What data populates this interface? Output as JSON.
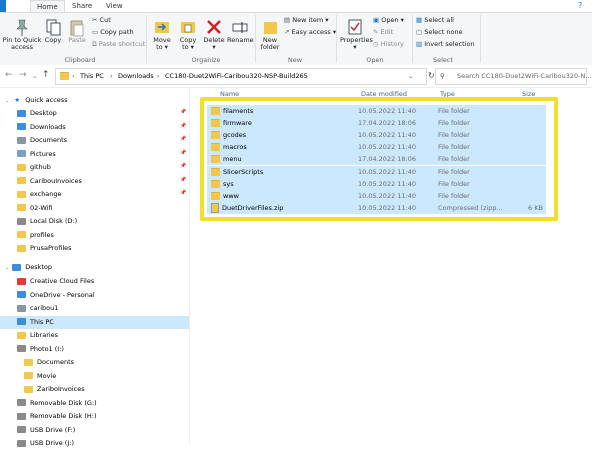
{
  "tabs": [
    "Home",
    "Share",
    "View"
  ],
  "ribbon": {
    "clipboard": {
      "pin": "Pin to Quick access",
      "copy": "Copy",
      "paste": "Paste",
      "cut": "Cut",
      "copy_path": "Copy path",
      "paste_shortcut": "Paste shortcut",
      "label": "Clipboard"
    },
    "organize": {
      "move_to": "Move to",
      "copy_to": "Copy to",
      "delete": "Delete",
      "rename": "Rename",
      "label": "Organize"
    },
    "new": {
      "new_folder": "New folder",
      "new_item": "New item",
      "easy_access": "Easy access",
      "label": "New"
    },
    "open": {
      "properties": "Properties",
      "open": "Open",
      "edit": "Edit",
      "history": "History",
      "label": "Open"
    },
    "select": {
      "select_all": "Select all",
      "select_none": "Select none",
      "invert": "Invert selection",
      "label": "Select"
    }
  },
  "address": {
    "crumbs": [
      "This PC",
      "Downloads",
      "CC180-Duet2WiFi-Caribou320-NSP-Build265"
    ],
    "search_placeholder": "Search CC180-Duet2WiFi-Caribou320-N..."
  },
  "columns": {
    "name": "Name",
    "date": "Date modified",
    "type": "Type",
    "size": "Size"
  },
  "sidebar": {
    "quick_access": "Quick access",
    "items": [
      {
        "label": "Desktop",
        "pinned": true
      },
      {
        "label": "Downloads",
        "pinned": true
      },
      {
        "label": "Documents",
        "pinned": true
      },
      {
        "label": "Pictures",
        "pinned": true
      },
      {
        "label": "github",
        "pinned": true
      },
      {
        "label": "CaribouInvoices",
        "pinned": true
      },
      {
        "label": "exchange",
        "pinned": true
      },
      {
        "label": "02-Wifi",
        "pinned": false
      },
      {
        "label": "Local Disk (D:)",
        "pinned": false
      },
      {
        "label": "profiles",
        "pinned": false
      },
      {
        "label": "PrusaProfiles",
        "pinned": false
      }
    ],
    "desktop": "Desktop",
    "tree": [
      "Creative Cloud Files",
      "OneDrive - Personal",
      "caribou1",
      "This PC",
      "Libraries",
      "Photo1 (I:)",
      "Documents",
      "Movie",
      "ZariboInvoices",
      "Removable Disk (G:)",
      "Removable Disk (H:)",
      "USB Drive (F:)",
      "USB Drive (J:)"
    ]
  },
  "files": [
    {
      "name": "filaments",
      "date": "10.05.2022 11:40",
      "type": "File folder",
      "size": ""
    },
    {
      "name": "firmware",
      "date": "17.04.2022 18:06",
      "type": "File folder",
      "size": ""
    },
    {
      "name": "gcodes",
      "date": "10.05.2022 11:40",
      "type": "File folder",
      "size": ""
    },
    {
      "name": "macros",
      "date": "10.05.2022 11:40",
      "type": "File folder",
      "size": ""
    },
    {
      "name": "menu",
      "date": "17.04.2022 18:06",
      "type": "File folder",
      "size": ""
    },
    {
      "name": "SlicerScripts",
      "date": "10.05.2022 11:40",
      "type": "File folder",
      "size": ""
    },
    {
      "name": "sys",
      "date": "10.05.2022 11:40",
      "type": "File folder",
      "size": ""
    },
    {
      "name": "www",
      "date": "10.05.2022 11:40",
      "type": "File folder",
      "size": ""
    },
    {
      "name": "DuetDriverFiles.zip",
      "date": "10.05.2022 11:40",
      "type": "Compressed (zipp...",
      "size": "6 KB"
    }
  ],
  "colors": {
    "selection": "#cce8ff",
    "highlight_border": "#f0e02c",
    "folder": "#f1c84b",
    "accent": "#0078d7"
  }
}
